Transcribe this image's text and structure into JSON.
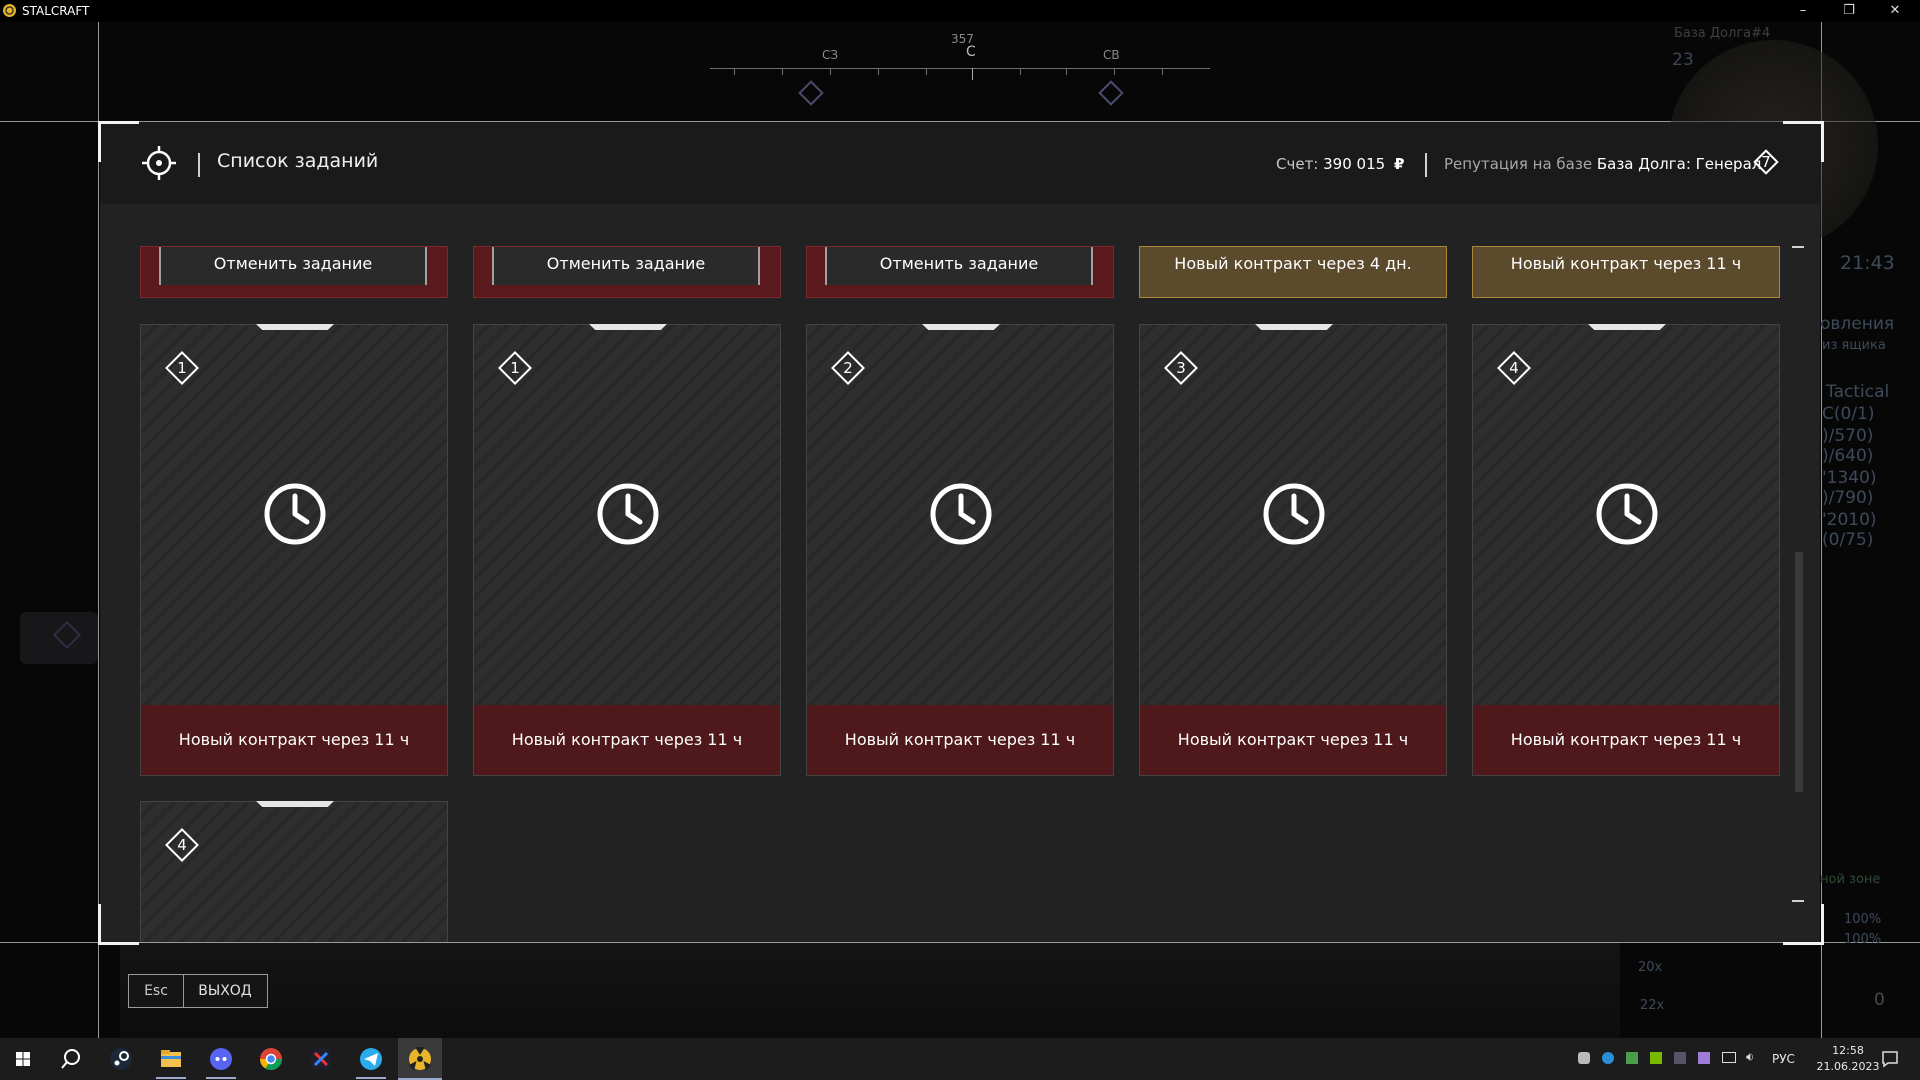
{
  "window": {
    "title": "STALCRAFT",
    "controls": {
      "minimize": "–",
      "restore": "❐",
      "close": "✕"
    }
  },
  "hud": {
    "compass": {
      "heading": "357",
      "center": "С",
      "left": "СЗ",
      "right": "СВ"
    },
    "minimap": {
      "location": "База Долга#4",
      "level": "23",
      "time": "21:43"
    },
    "quest_fragments": [
      "овления",
      "из ящика",
      "Tactical",
      "С(0/1)",
      ")/570)",
      ")/640)",
      "'1340)",
      ")/790)",
      "'2010)",
      "(0/75)"
    ],
    "zone_text": "ной зоне",
    "stats": [
      "100%",
      "100%"
    ],
    "ammo": {
      "stack1": "20x",
      "stack2": "22x",
      "count": "0"
    }
  },
  "modal": {
    "title": "Список заданий",
    "score_label": "Счет:",
    "score_value": "390 015",
    "currency_icon": "₽",
    "reputation_label": "Репутация на базе",
    "reputation_value": "База Долга: Генерал",
    "rank": "7",
    "top_row": [
      {
        "text": "Отменить задание",
        "style": "cancel"
      },
      {
        "text": "Отменить задание",
        "style": "cancel"
      },
      {
        "text": "Отменить задание",
        "style": "cancel"
      },
      {
        "text": "Новый контракт через 4 дн.",
        "style": "gold"
      },
      {
        "text": "Новый контракт через 11 ч",
        "style": "gold"
      }
    ],
    "cards": [
      {
        "tier": "1",
        "footer": "Новый контракт через 11 ч"
      },
      {
        "tier": "1",
        "footer": "Новый контракт через 11 ч"
      },
      {
        "tier": "2",
        "footer": "Новый контракт через 11 ч"
      },
      {
        "tier": "3",
        "footer": "Новый контракт через 11 ч"
      },
      {
        "tier": "4",
        "footer": "Новый контракт через 11 ч"
      }
    ],
    "partial_card": {
      "tier": "4"
    }
  },
  "exit": {
    "key": "Esc",
    "label": "ВЫХОД"
  },
  "taskbar": {
    "language": "РУС",
    "time": "12:58",
    "date": "21.06.2023",
    "apps": [
      "windows-start",
      "search",
      "steam",
      "file-explorer",
      "discord",
      "chrome",
      "app-x",
      "telegram",
      "stalcraft"
    ]
  },
  "colors": {
    "panel": "#222222",
    "header": "#1a1a1a",
    "cancel_red": "#5a1a1d",
    "gold": "#5b4a2c",
    "footer_red": "#4f191b"
  }
}
